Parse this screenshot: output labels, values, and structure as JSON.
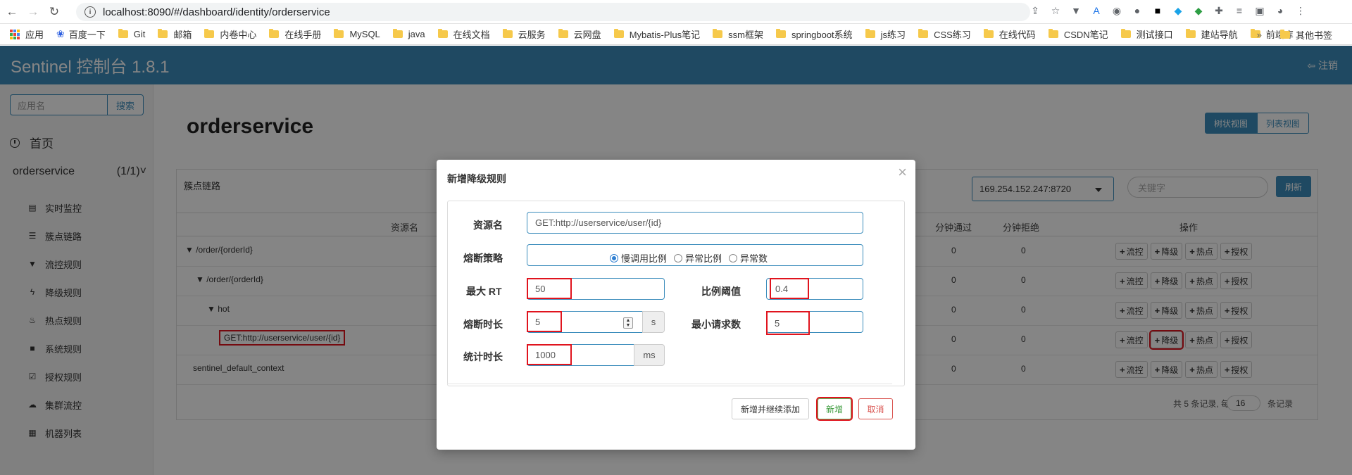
{
  "browser": {
    "url": "localhost:8090/#/dashboard/identity/orderservice",
    "bookmarks": [
      "应用",
      "百度一下",
      "Git",
      "邮箱",
      "内卷中心",
      "在线手册",
      "MySQL",
      "java",
      "在线文档",
      "云服务",
      "云网盘",
      "Mybatis-Plus笔记",
      "ssm框架",
      "springboot系统",
      "js练习",
      "CSS练习",
      "在线代码",
      "CSDN笔记",
      "测试接口",
      "建站导航",
      "前端库"
    ],
    "more_bookmarks": "其他书签"
  },
  "app": {
    "brand": "Sentinel 控制台 1.8.1",
    "logout": "注销",
    "colors": {
      "primary": "#3c8dbc",
      "highlight": "#e0141e"
    }
  },
  "sidebar": {
    "search_placeholder": "应用名",
    "search_button": "搜索",
    "home": "首页",
    "app_name": "orderservice",
    "app_count": "(1/1)",
    "menu": [
      {
        "icon": "bar-chart-icon",
        "glyph": "▤",
        "label": "实时监控"
      },
      {
        "icon": "list-icon",
        "glyph": "☰",
        "label": "簇点链路"
      },
      {
        "icon": "filter-icon",
        "glyph": "▼",
        "label": "流控规则"
      },
      {
        "icon": "flash-icon",
        "glyph": "ϟ",
        "label": "降级规则"
      },
      {
        "icon": "fire-icon",
        "glyph": "♨",
        "label": "热点规则"
      },
      {
        "icon": "lock-icon",
        "glyph": "■",
        "label": "系统规则"
      },
      {
        "icon": "check-icon",
        "glyph": "☑",
        "label": "授权规则"
      },
      {
        "icon": "cloud-icon",
        "glyph": "☁",
        "label": "集群流控"
      },
      {
        "icon": "grid-icon",
        "glyph": "▦",
        "label": "机器列表"
      }
    ]
  },
  "main": {
    "title": "orderservice",
    "view_tree": "树状视图",
    "view_list": "列表视图",
    "panel_title": "簇点链路",
    "machine": "169.254.152.247:8720",
    "keyword_placeholder": "关键字",
    "refresh": "刷新",
    "columns": {
      "resource": "资源名",
      "pass_min": "分钟通过",
      "reject_min": "分钟拒绝",
      "ops": "操作"
    },
    "rows": [
      {
        "prefix": "▼ ",
        "name": "/order/{orderId}",
        "pass": "0",
        "reject": "0"
      },
      {
        "prefix": "▼ ",
        "name": "/order/{orderId}",
        "pass": "0",
        "reject": "0"
      },
      {
        "prefix": "▼ ",
        "name": "hot",
        "pass": "0",
        "reject": "0"
      },
      {
        "prefix": "",
        "name": "GET:http://userservice/user/{id}",
        "pass": "0",
        "reject": "0"
      },
      {
        "prefix": "",
        "name": "sentinel_default_context",
        "pass": "0",
        "reject": "0"
      }
    ],
    "op_labels": {
      "flow": "流控",
      "degrade": "降级",
      "hot": "热点",
      "auth": "授权"
    },
    "pager": {
      "prefix": "共 5 条记录, 每页",
      "size": "16",
      "suffix": "条记录"
    }
  },
  "modal": {
    "title": "新增降级规则",
    "labels": {
      "resource": "资源名",
      "strategy": "熔断策略",
      "max_rt": "最大 RT",
      "ratio": "比例阈值",
      "duration": "熔断时长",
      "min_requests": "最小请求数",
      "stat_duration": "统计时长"
    },
    "values": {
      "resource": "GET:http://userservice/user/{id}",
      "max_rt": "50",
      "ratio": "0.4",
      "duration": "5",
      "min_requests": "5",
      "stat_duration": "1000"
    },
    "units": {
      "duration": "s",
      "stat_duration": "ms"
    },
    "strategies": [
      "慢调用比例",
      "异常比例",
      "异常数"
    ],
    "buttons": {
      "add_continue": "新增并继续添加",
      "add": "新增",
      "cancel": "取消"
    }
  }
}
